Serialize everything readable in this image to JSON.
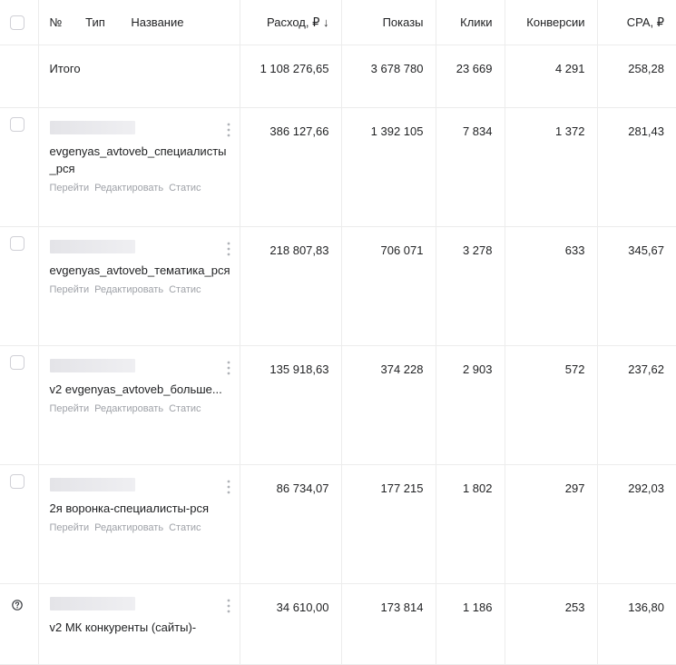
{
  "header": {
    "number": "№",
    "type": "Тип",
    "name": "Название",
    "spend": "Расход, ₽ ↓",
    "impressions": "Показы",
    "clicks": "Клики",
    "conversions": "Конверсии",
    "cpa": "CPA, ₽"
  },
  "total": {
    "label": "Итого",
    "spend": "1 108 276,65",
    "impressions": "3 678 780",
    "clicks": "23 669",
    "conversions": "4 291",
    "cpa": "258,28"
  },
  "actions": {
    "go": "Перейти",
    "edit": "Редактировать",
    "stats": "Статис"
  },
  "rows": [
    {
      "name": "evgenyas_avtoveb_специалисты_рся",
      "spend": "386 127,66",
      "impressions": "1 392 105",
      "clicks": "7 834",
      "conversions": "1 372",
      "cpa": "281,43"
    },
    {
      "name": "evgenyas_avtoveb_тематика_рся",
      "spend": "218 807,83",
      "impressions": "706 071",
      "clicks": "3 278",
      "conversions": "633",
      "cpa": "345,67"
    },
    {
      "name": "v2 evgenyas_avtoveb_больше...",
      "spend": "135 918,63",
      "impressions": "374 228",
      "clicks": "2 903",
      "conversions": "572",
      "cpa": "237,62"
    },
    {
      "name": "2я воронка-специалисты-рся",
      "spend": "86 734,07",
      "impressions": "177 215",
      "clicks": "1 802",
      "conversions": "297",
      "cpa": "292,03"
    },
    {
      "name": "v2 МК конкуренты (сайты)-",
      "spend": "34 610,00",
      "impressions": "173 814",
      "clicks": "1 186",
      "conversions": "253",
      "cpa": "136,80"
    }
  ]
}
